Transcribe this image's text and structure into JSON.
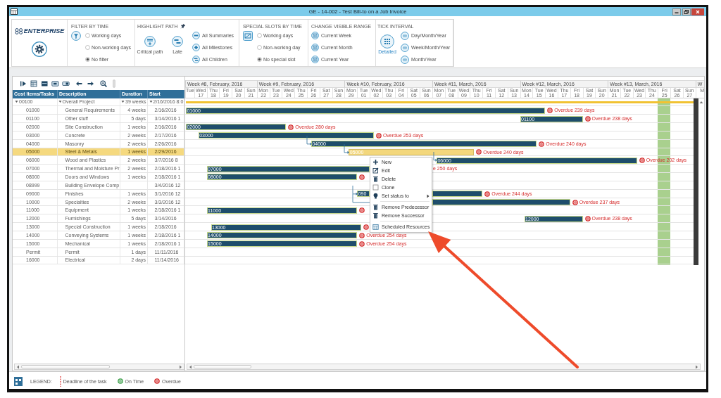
{
  "window": {
    "title": "GE - 14-002 - Test Bill-to on a Job Invoice"
  },
  "ribbon": {
    "logo": "ENTERPRISE",
    "groups": [
      {
        "kind": "radio",
        "title": "FILTER BY TIME",
        "options": [
          {
            "label": "Working days",
            "selected": false
          },
          {
            "label": "Non-working days",
            "selected": false
          },
          {
            "label": "No filter",
            "selected": true
          }
        ]
      },
      {
        "kind": "highlight",
        "title": "HIGHLIGHT PATH",
        "buttons": [
          {
            "label": "Critical path"
          },
          {
            "label": "Late"
          }
        ],
        "items": [
          {
            "label": "All Summaries"
          },
          {
            "label": "All Milestones"
          },
          {
            "label": "All Children"
          }
        ]
      },
      {
        "kind": "radio",
        "title": "SPECIAL SLOTS BY TIME",
        "options": [
          {
            "label": "Working days",
            "selected": false
          },
          {
            "label": "Non-working day",
            "selected": false
          },
          {
            "label": "No special slot",
            "selected": true
          }
        ]
      },
      {
        "kind": "list",
        "title": "CHANGE VISIBLE RANGE",
        "items": [
          {
            "label": "Current Week"
          },
          {
            "label": "Current Month"
          },
          {
            "label": "Current Year"
          }
        ]
      },
      {
        "kind": "tick",
        "title": "TICK INTERVAL",
        "buttons": [
          {
            "label": "Detailed",
            "selected": true
          }
        ],
        "items": [
          {
            "label": "Day/Month/Year",
            "selected": false
          },
          {
            "label": "Week/Month/Year",
            "selected": false
          },
          {
            "label": "Month/Year",
            "selected": false
          }
        ]
      }
    ]
  },
  "grid": {
    "columns": [
      "Cost Items/Tasks",
      "Description",
      "Duration",
      "Start"
    ],
    "rows": [
      {
        "code": "00100",
        "description": "Overall Project",
        "duration": "39 weeks",
        "start": "2/16/2016 8:0",
        "selected": false,
        "expanded": true,
        "bar": {
          "kind": "summary"
        },
        "link": false,
        "children": [
          {
            "code": "01000",
            "description": "General Requirements",
            "duration": "4 weeks",
            "start": "2/16/2016",
            "selected": false,
            "bar": {
              "kind": "task",
              "label": "01000"
            },
            "link": false,
            "status": {
              "kind": "overdue",
              "text": "Overdue 239 days",
              "covered": false
            }
          },
          {
            "code": "01100",
            "description": "Other stuff",
            "duration": "5 days",
            "start": "3/14/2016 1",
            "selected": false,
            "bar": {
              "kind": "task",
              "label": "01100"
            },
            "link": false,
            "status": {
              "kind": "overdue",
              "text": "Overdue 238 days",
              "covered": false
            }
          },
          {
            "code": "02000",
            "description": "Site Construction",
            "duration": "1 weeks",
            "start": "2/16/2016",
            "selected": false,
            "bar": {
              "kind": "task",
              "label": "02000"
            },
            "link": false,
            "status": {
              "kind": "overdue",
              "text": "Overdue 280 days",
              "covered": false
            }
          },
          {
            "code": "03000",
            "description": "Concrete",
            "duration": "2 weeks",
            "start": "2/17/2016",
            "selected": false,
            "bar": {
              "kind": "task",
              "label": "03000"
            },
            "link": false,
            "status": {
              "kind": "overdue",
              "text": "Overdue 253 days",
              "covered": false
            }
          },
          {
            "code": "04000",
            "description": "Masonry",
            "duration": "2 weeks",
            "start": "2/26/2016",
            "selected": false,
            "bar": {
              "kind": "task",
              "label": "04000"
            },
            "link": true,
            "status": {
              "kind": "overdue",
              "text": "Overdue 240 days",
              "covered": false
            }
          },
          {
            "code": "05000",
            "description": "Steel & Metals",
            "duration": "1 weeks",
            "start": "2/29/2016",
            "selected": true,
            "bar": {
              "kind": "task",
              "label": "05000"
            },
            "link": true,
            "status": {
              "kind": "overdue",
              "text": "Overdue 240 days",
              "covered": false
            }
          },
          {
            "code": "06000",
            "description": "Wood and Plastics",
            "duration": "2 weeks",
            "start": "3/7/2016 8",
            "selected": false,
            "bar": {
              "kind": "task",
              "label": "06000"
            },
            "link": true,
            "status": {
              "kind": "overdue",
              "text": "Overdue 202 days",
              "covered": false
            }
          },
          {
            "code": "07000",
            "description": "Thermal and Moisture Pr",
            "duration": "2 weeks",
            "start": "2/18/2016 1",
            "selected": false,
            "bar": {
              "kind": "task",
              "label": "07000"
            },
            "link": false,
            "status": {
              "kind": "overdue",
              "text": "e 250 days",
              "covered": true
            }
          },
          {
            "code": "08000",
            "description": "Doors and Windows",
            "duration": "1 weeks",
            "start": "2/18/2016 1",
            "selected": false,
            "bar": {
              "kind": "task",
              "label": "08000"
            },
            "link": false,
            "status": {
              "kind": "overdue",
              "covered": false
            }
          },
          {
            "code": "08999",
            "description": "Building Envelope Comp",
            "start": "3/4/2016 12",
            "selected": false
          },
          {
            "code": "09000",
            "description": "Finishes",
            "duration": "1 weeks",
            "start": "3/1/2016 12",
            "selected": false,
            "bar": {
              "kind": "task",
              "label": "090"
            },
            "link": true,
            "status": {
              "kind": "overdue",
              "text": "Overdue 244 days",
              "covered": false
            }
          },
          {
            "code": "10000",
            "description": "Specialties",
            "duration": "2 weeks",
            "start": "3/3/2016 12",
            "selected": false,
            "bar": {
              "kind": "task"
            },
            "link": true,
            "status": {
              "kind": "overdue",
              "text": "Overdue 237 days",
              "covered": false
            }
          },
          {
            "code": "11000",
            "description": "Equipment",
            "duration": "1 weeks",
            "start": "2/18/2016 1",
            "selected": false,
            "bar": {
              "kind": "task",
              "label": "11000"
            },
            "link": false,
            "status": {
              "kind": "overdue",
              "covered": false
            }
          },
          {
            "code": "12000",
            "description": "Furnishings",
            "duration": "5 days",
            "start": "3/14/2016",
            "selected": false,
            "bar": {
              "kind": "task",
              "label": "12000"
            },
            "link": false,
            "status": {
              "kind": "overdue",
              "text": "Overdue 238 days",
              "covered": false
            }
          },
          {
            "code": "13000",
            "description": "Special Construction",
            "duration": "1 weeks",
            "start": "2/18/2016",
            "selected": false,
            "bar": {
              "kind": "task",
              "label": "13000"
            },
            "link": false,
            "status": {
              "kind": "overdue",
              "covered": false
            }
          },
          {
            "code": "14000",
            "description": "Conveying Systems",
            "duration": "1 weeks",
            "start": "2/18/2016 1",
            "selected": false,
            "bar": {
              "kind": "task",
              "label": "14000"
            },
            "link": false,
            "status": {
              "kind": "overdue",
              "text": "Overdue 254 days",
              "covered": false
            }
          },
          {
            "code": "15000",
            "description": "Mechanical",
            "duration": "1 weeks",
            "start": "2/18/2016 1",
            "selected": false,
            "bar": {
              "kind": "task",
              "label": "15000"
            },
            "link": false,
            "status": {
              "kind": "overdue",
              "text": "Overdue 254 days",
              "covered": false
            }
          },
          {
            "code": "Permit",
            "description": "Permit",
            "duration": "1 days",
            "start": "11/11/2016",
            "selected": false
          },
          {
            "code": "16000",
            "description": "Electrical",
            "duration": "2 days",
            "start": "11/14/2016",
            "selected": false
          }
        ]
      }
    ]
  },
  "gantt": {
    "weeks": [
      {
        "label": "Week #8, February, 2016",
        "days": [
          {
            "label": "Tue",
            "special": false
          },
          {
            "label": "Wed17",
            "special": false
          },
          {
            "label": "Thu18",
            "special": false
          },
          {
            "label": "Fri19",
            "special": false
          },
          {
            "label": "Sat20",
            "special": false
          },
          {
            "label": "Sun21",
            "special": false
          }
        ]
      },
      {
        "label": "Week #9, February, 2016",
        "days": [
          {
            "label": "Mon22",
            "special": false
          },
          {
            "label": "Tue23",
            "special": false
          },
          {
            "label": "Wed24",
            "special": false
          },
          {
            "label": "Thu25",
            "special": false
          },
          {
            "label": "Fri26",
            "special": false
          },
          {
            "label": "Sat27",
            "special": false
          },
          {
            "label": "Sun28",
            "special": false
          }
        ]
      },
      {
        "label": "Week #10, February, 2016",
        "days": [
          {
            "label": "Mon29",
            "special": false
          },
          {
            "label": "Tue01",
            "special": false
          },
          {
            "label": "Wed02",
            "special": false
          },
          {
            "label": "Thu03",
            "special": false
          },
          {
            "label": "Fri04",
            "special": false
          },
          {
            "label": "Sat05",
            "special": false
          },
          {
            "label": "Sun06",
            "special": false
          }
        ]
      },
      {
        "label": "Week #11, March, 2016",
        "days": [
          {
            "label": "Mon07",
            "special": false
          },
          {
            "label": "Tue08",
            "special": false
          },
          {
            "label": "Wed09",
            "special": false
          },
          {
            "label": "Thu10",
            "special": false
          },
          {
            "label": "Fri11",
            "special": false
          },
          {
            "label": "Sat12",
            "special": false
          },
          {
            "label": "Sun13",
            "special": false
          }
        ]
      },
      {
        "label": "Week #12, March, 2016",
        "days": [
          {
            "label": "Mon14",
            "special": false
          },
          {
            "label": "Tue15",
            "special": false
          },
          {
            "label": "Wed16",
            "special": false
          },
          {
            "label": "Thu17",
            "special": false
          },
          {
            "label": "Fri18",
            "special": false
          },
          {
            "label": "Sat19",
            "special": false
          },
          {
            "label": "Sun20",
            "special": false
          }
        ]
      },
      {
        "label": "Week #13, March, 2016",
        "days": [
          {
            "label": "Mon21",
            "special": false
          },
          {
            "label": "Tue22",
            "special": false
          },
          {
            "label": "Wed23",
            "special": false
          },
          {
            "label": "Thu24",
            "special": false
          },
          {
            "label": "Fri25",
            "special": true
          },
          {
            "label": "Sat26",
            "special": false
          },
          {
            "label": "Sun27",
            "special": false
          }
        ]
      },
      {
        "label": "W",
        "days": [
          {
            "label": "M",
            "special": false
          }
        ]
      }
    ]
  },
  "context_menu": {
    "items": [
      {
        "kind": "item",
        "label": "New"
      },
      {
        "kind": "item",
        "label": "Edit"
      },
      {
        "kind": "item",
        "label": "Delete"
      },
      {
        "kind": "item",
        "label": "Clone"
      },
      {
        "kind": "submenu",
        "label": "Set status to"
      },
      {
        "kind": "separator"
      },
      {
        "kind": "item",
        "label": "Remove Predecessor"
      },
      {
        "kind": "item",
        "label": "Remove Successor"
      },
      {
        "kind": "separator"
      },
      {
        "kind": "item",
        "label": "Scheduled Resources"
      }
    ]
  },
  "legend": {
    "title": "LEGEND:",
    "items": [
      {
        "kind": "deadline",
        "label": "Deadline of the task"
      },
      {
        "kind": "on_time",
        "label": "On Time"
      },
      {
        "kind": "overdue",
        "label": "Overdue"
      }
    ]
  },
  "annotation": {
    "kind": "arrow"
  }
}
